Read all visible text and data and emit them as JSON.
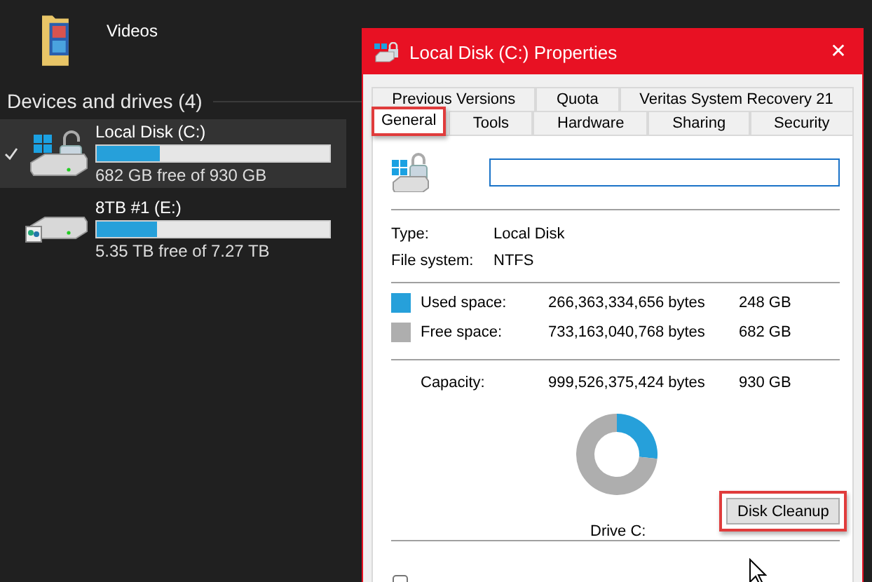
{
  "explorer": {
    "folder": {
      "label": "Videos"
    },
    "section": {
      "title": "Devices and drives (4)"
    },
    "drives": [
      {
        "kind": "system",
        "name": "Local Disk (C:)",
        "level": 0.27,
        "free": "682 GB free of 930 GB",
        "selected": true,
        "checked": true
      },
      {
        "kind": "network",
        "name": "8TB #1 (E:)",
        "level": 0.26,
        "free": "5.35 TB free of 7.27 TB",
        "selected": false,
        "checked": false
      }
    ]
  },
  "dialog": {
    "title": "Local Disk (C:) Properties",
    "close": "✕",
    "tab_rows": [
      {
        "tabs": [
          {
            "label": "Previous Versions",
            "selected": false,
            "highlighted": false
          },
          {
            "label": "Quota",
            "selected": false,
            "highlighted": false
          },
          {
            "label": "Veritas System Recovery 21",
            "selected": false,
            "highlighted": false
          }
        ]
      },
      {
        "tabs": [
          {
            "label": "General",
            "selected": true,
            "highlighted": true
          },
          {
            "label": "Tools",
            "selected": false,
            "highlighted": false
          },
          {
            "label": "Hardware",
            "selected": false,
            "highlighted": false
          },
          {
            "label": "Sharing",
            "selected": false,
            "highlighted": false
          },
          {
            "label": "Security",
            "selected": false,
            "highlighted": false
          }
        ]
      }
    ],
    "info": [
      {
        "label": "Type:",
        "value": "Local Disk"
      },
      {
        "label": "File system:",
        "value": "NTFS"
      }
    ],
    "space": [
      {
        "label": "Used space:",
        "bytes": "266,363,334,656 bytes",
        "size": "248 GB",
        "color": "#26a0da"
      },
      {
        "label": "Free space:",
        "bytes": "733,163,040,768 bytes",
        "size": "682 GB",
        "color": "#aeaeae"
      }
    ],
    "capacity": {
      "label": "Capacity:",
      "bytes": "999,526,375,424 bytes",
      "size": "930 GB"
    },
    "chart_data": {
      "type": "donut",
      "values": [
        26.7,
        73.3
      ]
    },
    "drive_label": "Drive C:",
    "cleanup_button": {
      "label": "Disk Cleanup",
      "highlighted": true
    },
    "compress": {
      "checked": false
    }
  }
}
